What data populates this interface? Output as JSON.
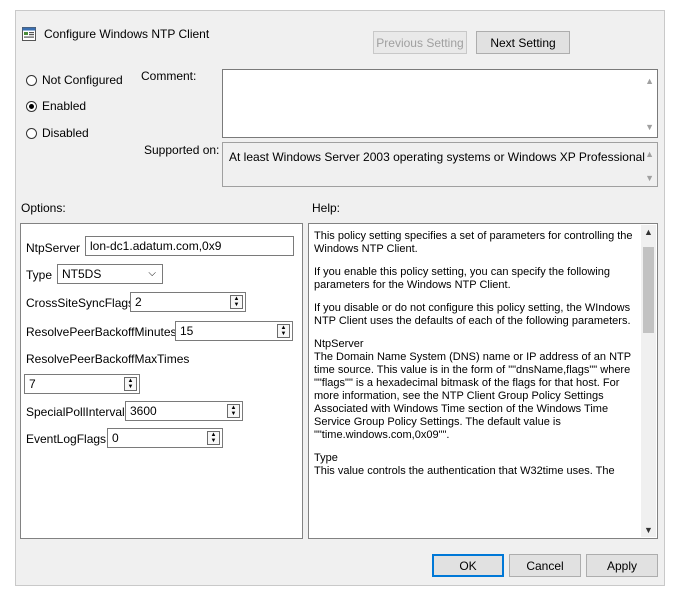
{
  "window": {
    "title": "Configure Windows NTP Client",
    "prev_setting": "Previous Setting",
    "next_setting": "Next Setting"
  },
  "state": {
    "options": [
      {
        "label": "Not Configured",
        "checked": false
      },
      {
        "label": "Enabled",
        "checked": true
      },
      {
        "label": "Disabled",
        "checked": false
      }
    ]
  },
  "labels": {
    "comment": "Comment:",
    "supported_on": "Supported on:",
    "supported_value": "At least Windows Server 2003 operating systems or Windows XP Professional",
    "options": "Options:",
    "help": "Help:"
  },
  "options_panel": {
    "ntp_server_label": "NtpServer",
    "ntp_server_value": "lon-dc1.adatum.com,0x9",
    "type_label": "Type",
    "type_value": "NT5DS",
    "cross_site_label": "CrossSiteSyncFlags",
    "cross_site_value": "2",
    "resolve_min_label": "ResolvePeerBackoffMinutes",
    "resolve_min_value": "15",
    "resolve_max_label": "ResolvePeerBackoffMaxTimes",
    "resolve_max_value": "7",
    "special_poll_label": "SpecialPollInterval",
    "special_poll_value": "3600",
    "event_log_label": "EventLogFlags",
    "event_log_value": "0"
  },
  "help": {
    "p1": "This policy setting specifies a set of parameters for controlling the Windows NTP Client.",
    "p2": "If you enable this policy setting, you can specify the following parameters for the Windows NTP Client.",
    "p3": "If you disable or do not configure this policy setting, the WIndows NTP Client uses the defaults of each of the following parameters.",
    "p4_title": "NtpServer",
    "p4_body": "The Domain Name System (DNS) name or IP address of an NTP time source. This value is in the form of \"\"dnsName,flags\"\" where \"\"flags\"\" is a hexadecimal bitmask of the flags for that host. For more information, see the NTP Client Group Policy Settings Associated with Windows Time section of the Windows Time Service Group Policy Settings.  The default value is \"\"time.windows.com,0x09\"\".",
    "p5_title": "Type",
    "p5_body": "This value controls the authentication that W32time uses. The"
  },
  "footer": {
    "ok": "OK",
    "cancel": "Cancel",
    "apply": "Apply"
  }
}
